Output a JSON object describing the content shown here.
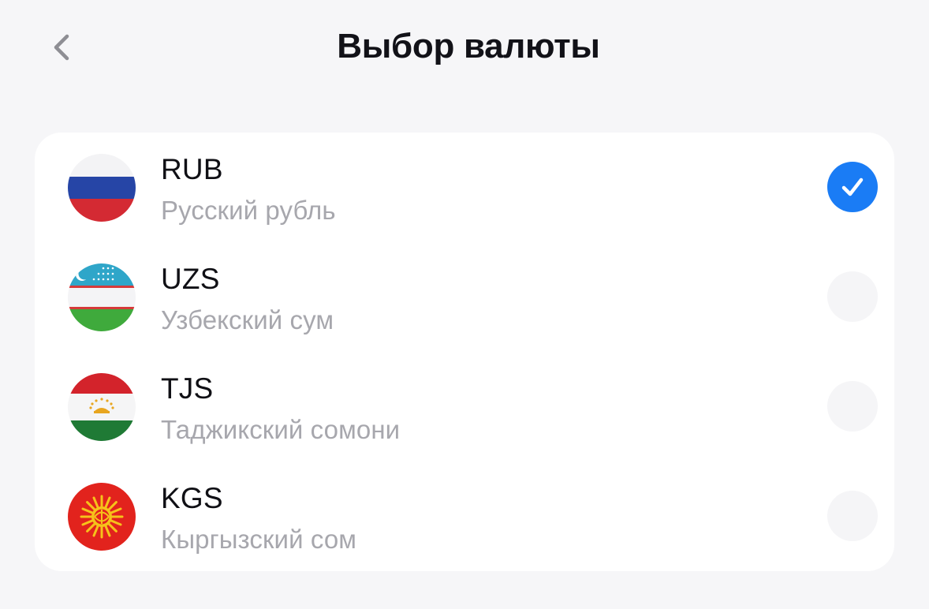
{
  "header": {
    "title": "Выбор валюты",
    "back_icon": "chevron-left-icon"
  },
  "colors": {
    "background": "#f6f6f8",
    "card": "#ffffff",
    "accent": "#1a7cf5",
    "secondary_text": "#a7a7ad",
    "radio_unselected": "#f5f5f7"
  },
  "currencies": [
    {
      "code": "RUB",
      "name": "Русский рубль",
      "flag": "russia-flag-icon",
      "selected": true
    },
    {
      "code": "UZS",
      "name": "Узбекский сум",
      "flag": "uzbekistan-flag-icon",
      "selected": false
    },
    {
      "code": "TJS",
      "name": "Таджикский сомони",
      "flag": "tajikistan-flag-icon",
      "selected": false
    },
    {
      "code": "KGS",
      "name": "Кыргызский сом",
      "flag": "kyrgyzstan-flag-icon",
      "selected": false
    }
  ]
}
